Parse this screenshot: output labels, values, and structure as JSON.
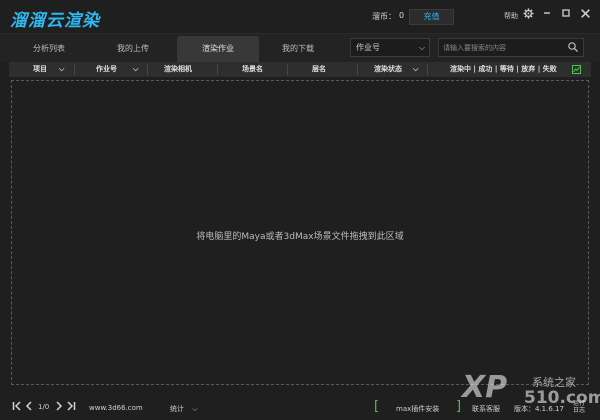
{
  "app": {
    "logo_text": "溜溜云渲染",
    "coin_label": "溜币：",
    "coin_value": "0",
    "recharge_label": "充值",
    "help_label": "帮助",
    "accent_color": "#2fb8f0"
  },
  "tabs": [
    {
      "label": "分析列表",
      "active": false
    },
    {
      "label": "我的上传",
      "active": false
    },
    {
      "label": "渲染作业",
      "active": true
    },
    {
      "label": "我的下载",
      "active": false
    }
  ],
  "filter": {
    "selected": "作业号",
    "search_placeholder": "请输入要搜索的内容"
  },
  "columns": {
    "project": "项目",
    "job_number": "作业号",
    "render_camera": "渲染相机",
    "scene_name": "场景名",
    "layer_name": "层名",
    "render_status": "渲染状态",
    "status_summary": "渲染中 | 成功 | 等待 | 放弃 | 失败"
  },
  "drop_area": {
    "hint": "将电脑里的Maya或者3dMax场景文件拖拽到此区域"
  },
  "footer": {
    "page": "1/0",
    "site": "www.3d66.com",
    "stats_label": "统计",
    "max_plugin_label": "max插件安装",
    "contact_label": "联系客服",
    "version_label": "版本：4.1.6.17",
    "log_label": "运行日志"
  },
  "watermark": {
    "brand": "XP",
    "name": "系统之家",
    "url": "510.com"
  }
}
